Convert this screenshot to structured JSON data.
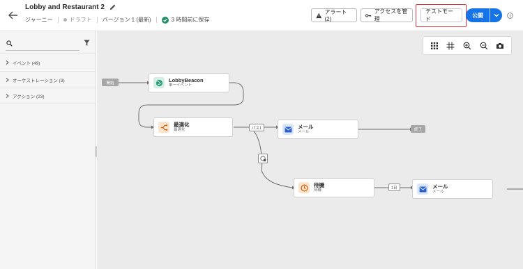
{
  "header": {
    "title": "Lobby and Restaurant 2",
    "journey_label": "ジャーニー",
    "status": "ドラフト",
    "version": "バージョン 1 (最新)",
    "saved": "3 時間前に保存",
    "alert_label": "アラート(2)",
    "access_label": "アクセスを管理",
    "test_mode_label": "テストモード",
    "publish_label": "公開"
  },
  "sidebar": {
    "search": {
      "value": "",
      "placeholder": ""
    },
    "categories": [
      {
        "label": "イベント (49)"
      },
      {
        "label": "オーケストレーション (3)"
      },
      {
        "label": "アクション (23)"
      }
    ]
  },
  "canvas": {
    "toolbar": [
      "grid-icon",
      "fit-icon",
      "zoom-in-icon",
      "zoom-out-icon",
      "camera-icon"
    ],
    "start_label": "開始",
    "end_label": "終了",
    "nodes": {
      "beacon": {
        "title": "LobbyBeacon",
        "subtitle": "単一イベント",
        "icon": "globe-icon"
      },
      "optimize": {
        "title": "最適化",
        "subtitle": "最適化",
        "icon": "split-icon"
      },
      "mail1": {
        "title": "メール",
        "subtitle": "メール",
        "icon": "envelope-icon"
      },
      "wait": {
        "title": "待機",
        "subtitle": "待機",
        "icon": "clock-icon"
      },
      "mail2": {
        "title": "メール",
        "subtitle": "メール",
        "icon": "envelope-icon"
      }
    },
    "path_tag": "パス1",
    "wait_tag": "1日"
  },
  "colors": {
    "accent": "#1473e6",
    "highlight": "#d6333a",
    "globe_bg": "#d6efe6",
    "optimize_bg": "#fbe4cc",
    "mail_bg": "#dbe6fb",
    "wait_bg": "#fbe4cc"
  }
}
